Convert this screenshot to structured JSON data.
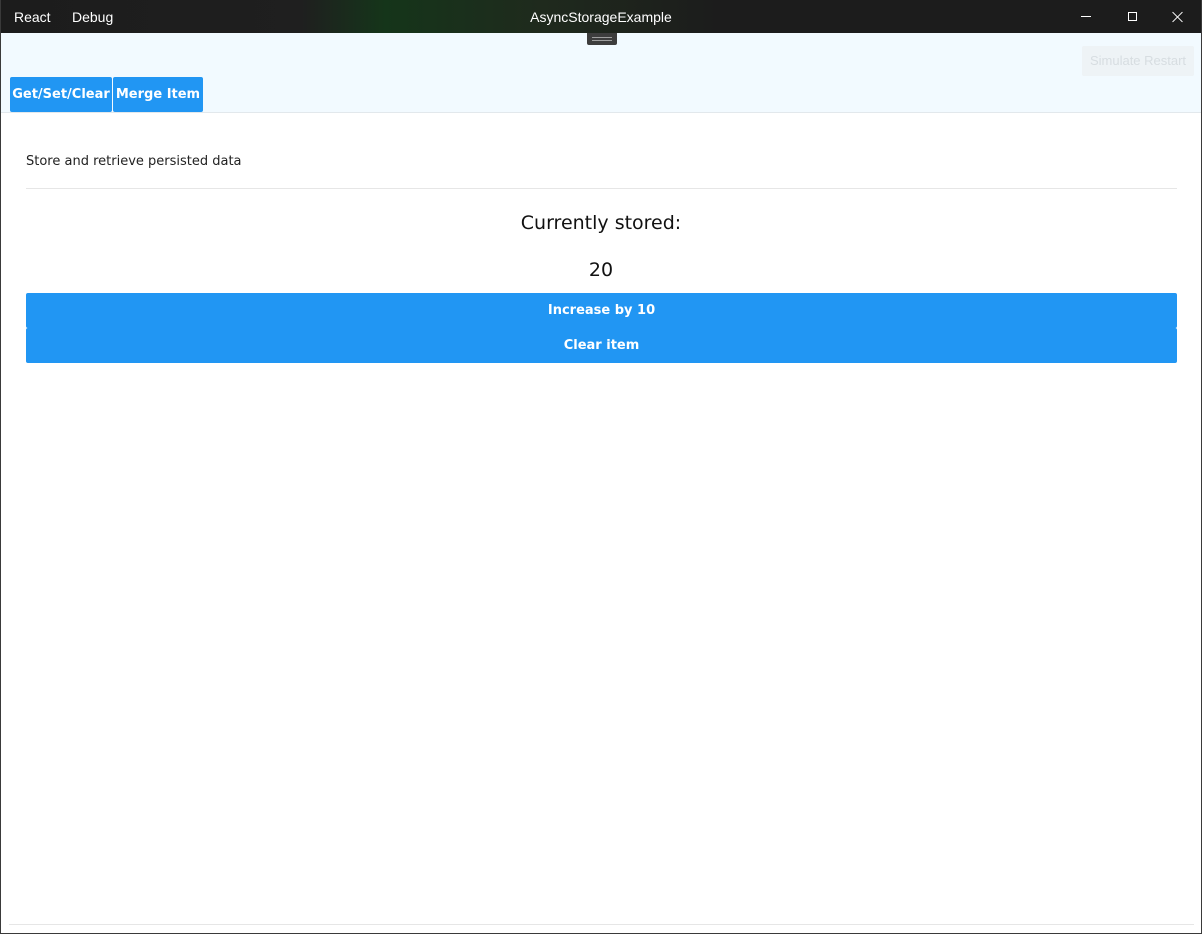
{
  "titlebar": {
    "menu": [
      "React",
      "Debug"
    ],
    "title": "AsyncStorageExample"
  },
  "header": {
    "simulate_restart_label": "Simulate Restart",
    "tabs": [
      {
        "label": "Get/Set/Clear"
      },
      {
        "label": "Merge Item"
      }
    ]
  },
  "main": {
    "subtitle": "Store and retrieve persisted data",
    "stored_label": "Currently stored:",
    "stored_value": "20",
    "increase_label": "Increase by 10",
    "clear_label": "Clear item"
  },
  "colors": {
    "accent": "#2196f3",
    "titlebar": "#1c1c1c",
    "header_band": "#f2faff"
  },
  "icons": [
    "minimize-icon",
    "maximize-icon",
    "close-icon",
    "drag-handle-icon"
  ]
}
